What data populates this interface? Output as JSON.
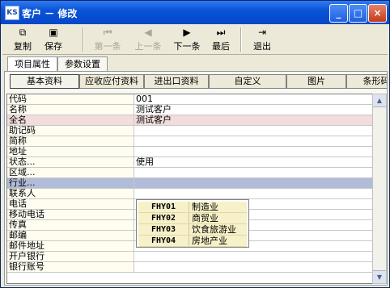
{
  "window": {
    "title": "客户 － 修改",
    "app_icon_text": "KS",
    "buttons": {
      "minimize": "_",
      "maximize": "□",
      "close": "×"
    }
  },
  "toolbar": {
    "copy": {
      "label": "复制",
      "icon": "copy-icon"
    },
    "save": {
      "label": "保存",
      "icon": "save-icon"
    },
    "first": {
      "label": "第一条",
      "icon": "first-icon",
      "enabled": false
    },
    "prev": {
      "label": "上一条",
      "icon": "prev-icon",
      "enabled": false
    },
    "next": {
      "label": "下一条",
      "icon": "next-icon",
      "enabled": true
    },
    "last": {
      "label": "最后",
      "icon": "last-icon",
      "enabled": true
    },
    "exit": {
      "label": "退出",
      "icon": "exit-icon"
    }
  },
  "outer_tabs": [
    "项目属性",
    "参数设置"
  ],
  "inner_tabs": [
    "基本资料",
    "应收应付资料",
    "进出口资料",
    "自定义",
    "图片",
    "条形码"
  ],
  "rows": [
    {
      "label": "代码",
      "value": "001"
    },
    {
      "label": "名称",
      "value": "测试客户"
    },
    {
      "label": "全名",
      "value": "测试客户"
    },
    {
      "label": "助记码",
      "value": ""
    },
    {
      "label": "简称",
      "value": ""
    },
    {
      "label": "地址",
      "value": ""
    },
    {
      "label": "状态...",
      "value": "使用"
    },
    {
      "label": "区域...",
      "value": ""
    },
    {
      "label": "行业...",
      "value": ""
    },
    {
      "label": "联系人",
      "value": ""
    },
    {
      "label": "电话",
      "value": ""
    },
    {
      "label": "移动电话",
      "value": ""
    },
    {
      "label": "传真",
      "value": ""
    },
    {
      "label": "邮编",
      "value": ""
    },
    {
      "label": "邮件地址",
      "value": ""
    },
    {
      "label": "开户银行",
      "value": ""
    },
    {
      "label": "银行账号",
      "value": ""
    }
  ],
  "industry_dropdown": [
    {
      "code": "FHY01",
      "name": "制造业"
    },
    {
      "code": "FHY02",
      "name": "商贸业"
    },
    {
      "code": "FHY03",
      "name": "饮食旅游业"
    },
    {
      "code": "FHY04",
      "name": "房地产业"
    }
  ],
  "colors": {
    "title_bar": "#0a53d8",
    "selected_row": "#b0bcd8",
    "highlight_row": "#f2dcdc",
    "dropdown_bg": "#f6f1c8"
  }
}
